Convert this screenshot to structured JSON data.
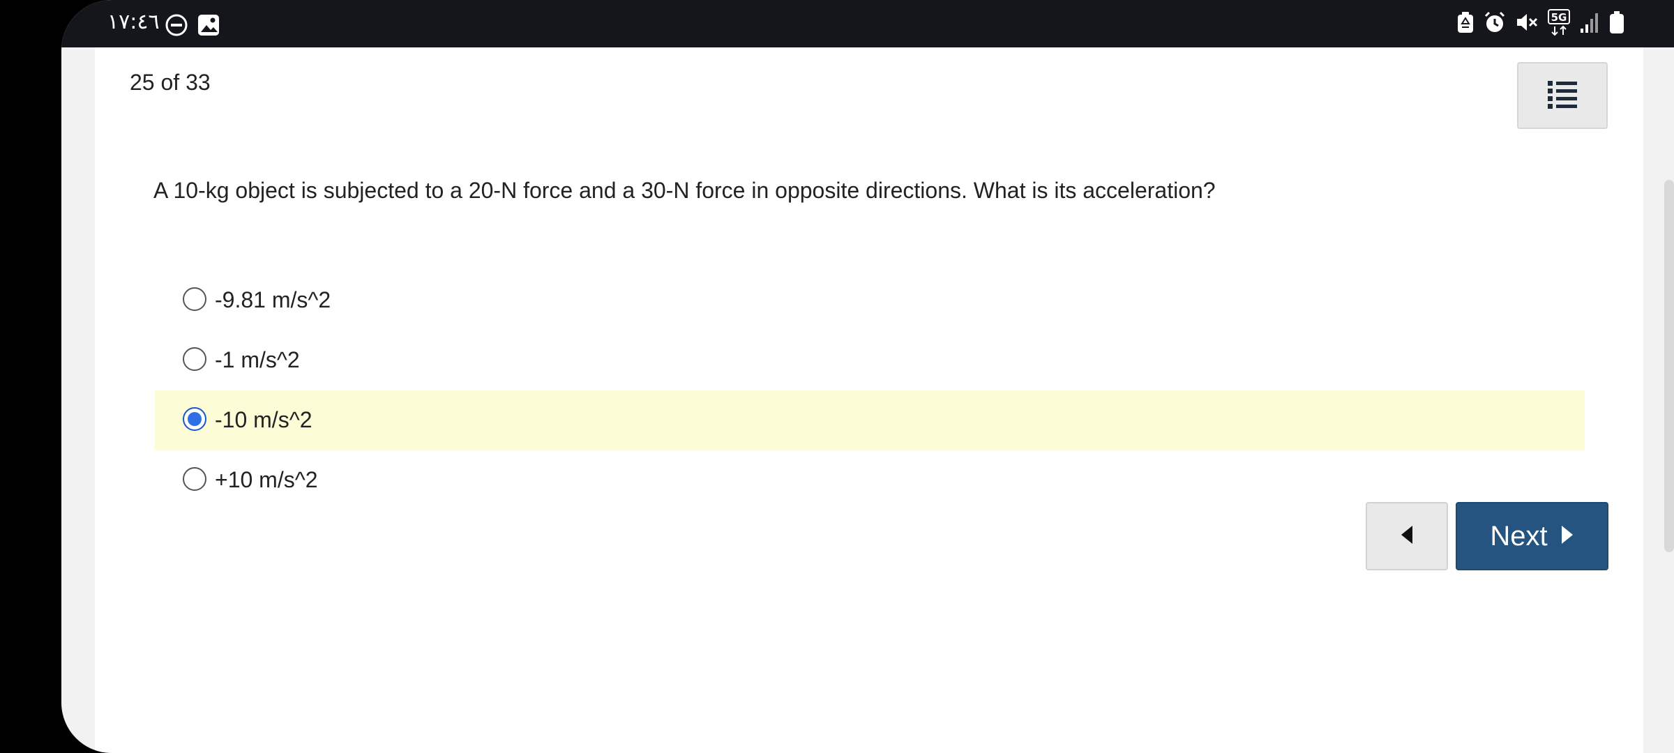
{
  "status_bar": {
    "time": "١٧:٤٦",
    "left_icons": [
      "do-not-disturb-icon",
      "gallery-icon"
    ],
    "right_icons": [
      "recycle-icon",
      "alarm-icon",
      "mute-icon",
      "network-5g-icon",
      "signal-icon",
      "battery-icon"
    ],
    "network_label": "5G"
  },
  "quiz": {
    "counter": "25 of 33",
    "question": "A 10-kg object is subjected to a 20-N force and a 30-N force in opposite directions. What is its acceleration?",
    "options": [
      {
        "label": "-9.81 m/s^2",
        "selected": false
      },
      {
        "label": "-1 m/s^2",
        "selected": false
      },
      {
        "label": "-10 m/s^2",
        "selected": true
      },
      {
        "label": "+10 m/s^2",
        "selected": false
      }
    ]
  },
  "nav": {
    "list_icon": "list-icon",
    "prev_icon": "caret-left-icon",
    "next_label": "Next",
    "next_icon": "caret-right-icon"
  },
  "colors": {
    "selected_bg": "#fcfcd7",
    "next_button": "#24547f",
    "radio_checked": "#2f6fe3"
  }
}
